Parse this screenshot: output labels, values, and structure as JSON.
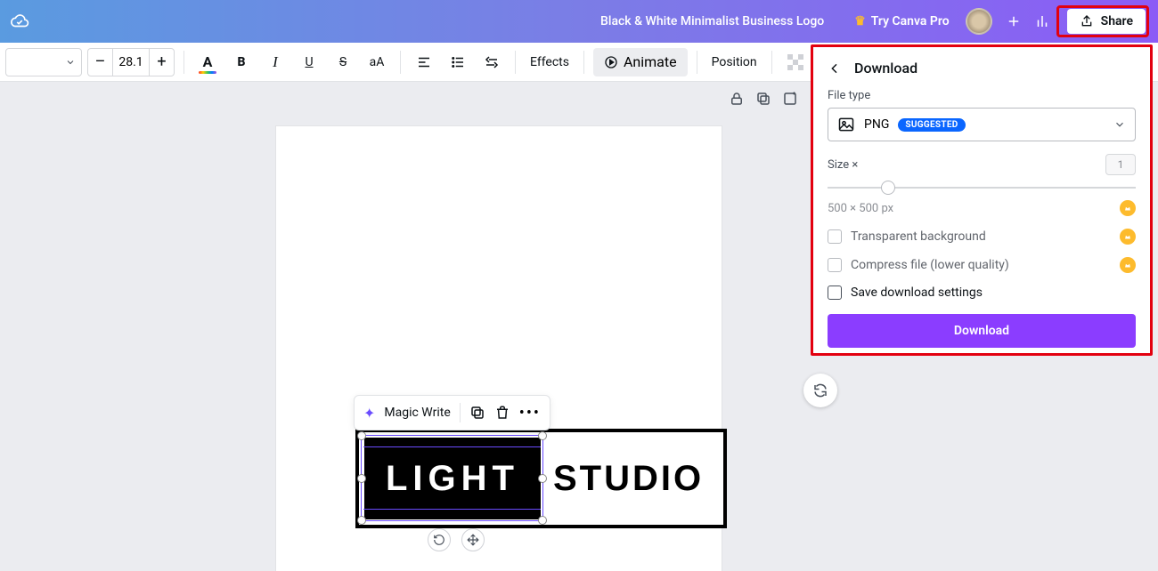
{
  "header": {
    "doc_title": "Black & White Minimalist Business Logo",
    "try_pro": "Try Canva Pro",
    "share": "Share"
  },
  "toolbar": {
    "font_size": "28.1",
    "effects": "Effects",
    "animate": "Animate",
    "position": "Position"
  },
  "mini_toolbar": {
    "magic_write": "Magic Write"
  },
  "logo": {
    "left": "LIGHT",
    "right": "STUDIO"
  },
  "panel": {
    "title": "Download",
    "file_type_label": "File type",
    "file_type_value": "PNG",
    "file_type_badge": "SUGGESTED",
    "size_label": "Size ×",
    "size_value": "1",
    "dimensions": "500 × 500 px",
    "opt_transparent": "Transparent background",
    "opt_compress": "Compress file (lower quality)",
    "opt_save": "Save download settings",
    "download_btn": "Download"
  }
}
